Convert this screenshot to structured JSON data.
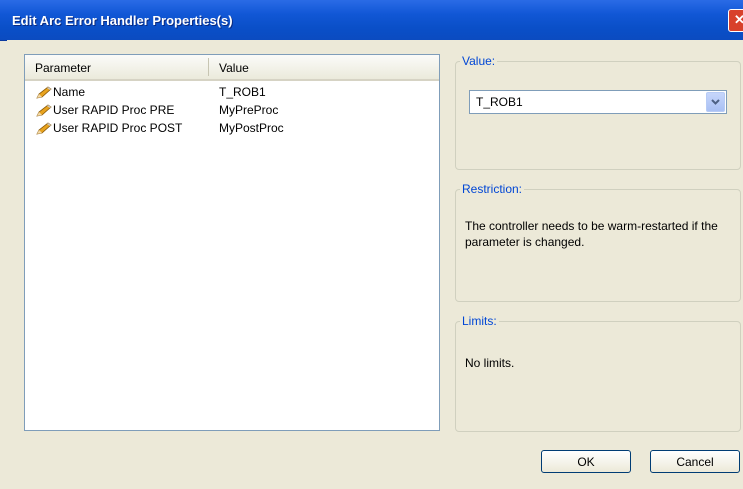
{
  "window": {
    "title": "Edit Arc Error Handler Properties(s)"
  },
  "list": {
    "columns": [
      "Parameter",
      "Value"
    ],
    "rows": [
      {
        "parameter": "Name",
        "value": "T_ROB1"
      },
      {
        "parameter": "User RAPID Proc PRE",
        "value": "MyPreProc"
      },
      {
        "parameter": "User RAPID Proc POST",
        "value": "MyPostProc"
      }
    ]
  },
  "value_group": {
    "legend": "Value:",
    "selected": "T_ROB1"
  },
  "restriction_group": {
    "legend": "Restriction:",
    "text": "The controller needs to be warm-restarted if the parameter is changed."
  },
  "limits_group": {
    "legend": "Limits:",
    "text": "No limits."
  },
  "buttons": {
    "ok": "OK",
    "cancel": "Cancel"
  },
  "colors": {
    "titlebar": "#0a4fc8",
    "legend_text": "#0046d5",
    "dialog_bg": "#ece9d8"
  },
  "icons": {
    "row_icon": "pencil-icon",
    "combo_arrow": "chevron-down-icon",
    "close": "close-icon"
  }
}
